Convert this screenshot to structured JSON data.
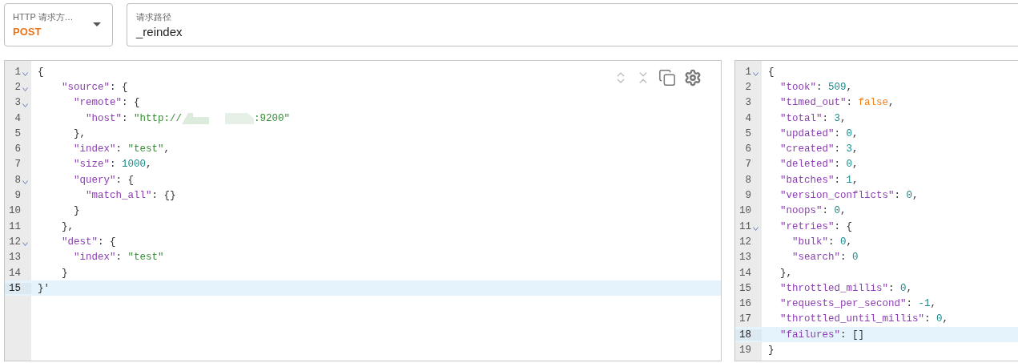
{
  "method_field": {
    "label": "HTTP 请求方…",
    "value": "POST"
  },
  "path_field": {
    "label": "请求路径",
    "value": "_reindex"
  },
  "request_editor": {
    "toolbar": [
      {
        "kind": "unfold"
      },
      {
        "kind": "fold"
      },
      {
        "kind": "copy"
      },
      {
        "kind": "settings"
      }
    ],
    "lines": [
      {
        "number": "1",
        "foldable": true,
        "active": false,
        "tokens": [
          {
            "kind": "punct",
            "text": "{"
          }
        ]
      },
      {
        "number": "2",
        "foldable": true,
        "active": false,
        "tokens": [
          {
            "kind": "key",
            "text": "    ″source″"
          },
          {
            "kind": "punct",
            "text": ": {"
          }
        ]
      },
      {
        "number": "3",
        "foldable": true,
        "active": false,
        "tokens": [
          {
            "kind": "key",
            "text": "      ″remote″"
          },
          {
            "kind": "punct",
            "text": ": {"
          }
        ]
      },
      {
        "number": "4",
        "foldable": false,
        "active": false,
        "tokens": [
          {
            "kind": "key",
            "text": "        ″host″"
          },
          {
            "kind": "punct",
            "text": ": "
          },
          {
            "kind": "string",
            "text": "″http://"
          },
          {
            "kind": "redacted"
          },
          {
            "kind": "string",
            "text": ":9200″"
          }
        ]
      },
      {
        "number": "5",
        "foldable": false,
        "active": false,
        "tokens": [
          {
            "kind": "punct",
            "text": "      },"
          }
        ]
      },
      {
        "number": "6",
        "foldable": false,
        "active": false,
        "tokens": [
          {
            "kind": "key",
            "text": "      ″index″"
          },
          {
            "kind": "punct",
            "text": ": "
          },
          {
            "kind": "string",
            "text": "″test″"
          },
          {
            "kind": "punct",
            "text": ","
          }
        ]
      },
      {
        "number": "7",
        "foldable": false,
        "active": false,
        "tokens": [
          {
            "kind": "key",
            "text": "      ″size″"
          },
          {
            "kind": "punct",
            "text": ": "
          },
          {
            "kind": "number",
            "text": "1000"
          },
          {
            "kind": "punct",
            "text": ","
          }
        ]
      },
      {
        "number": "8",
        "foldable": true,
        "active": false,
        "tokens": [
          {
            "kind": "key",
            "text": "      ″query″"
          },
          {
            "kind": "punct",
            "text": ": {"
          }
        ]
      },
      {
        "number": "9",
        "foldable": false,
        "active": false,
        "tokens": [
          {
            "kind": "key",
            "text": "        ″match_all″"
          },
          {
            "kind": "punct",
            "text": ": {}"
          }
        ]
      },
      {
        "number": "10",
        "foldable": false,
        "active": false,
        "tokens": [
          {
            "kind": "punct",
            "text": "      }"
          }
        ]
      },
      {
        "number": "11",
        "foldable": false,
        "active": false,
        "tokens": [
          {
            "kind": "punct",
            "text": "    },"
          }
        ]
      },
      {
        "number": "12",
        "foldable": true,
        "active": false,
        "tokens": [
          {
            "kind": "key",
            "text": "    ″dest″"
          },
          {
            "kind": "punct",
            "text": ": {"
          }
        ]
      },
      {
        "number": "13",
        "foldable": false,
        "active": false,
        "tokens": [
          {
            "kind": "key",
            "text": "      ″index″"
          },
          {
            "kind": "punct",
            "text": ": "
          },
          {
            "kind": "string",
            "text": "″test″"
          }
        ]
      },
      {
        "number": "14",
        "foldable": false,
        "active": false,
        "tokens": [
          {
            "kind": "punct",
            "text": "    }"
          }
        ]
      },
      {
        "number": "15",
        "foldable": false,
        "active": true,
        "tokens": [
          {
            "kind": "punct",
            "text": "}'"
          }
        ]
      }
    ]
  },
  "response_editor": {
    "lines": [
      {
        "number": "1",
        "foldable": true,
        "active": false,
        "tokens": [
          {
            "kind": "punct",
            "text": "{"
          }
        ]
      },
      {
        "number": "2",
        "foldable": false,
        "active": false,
        "tokens": [
          {
            "kind": "key",
            "text": "  ″took″"
          },
          {
            "kind": "punct",
            "text": ": "
          },
          {
            "kind": "number",
            "text": "509"
          },
          {
            "kind": "punct",
            "text": ","
          }
        ]
      },
      {
        "number": "3",
        "foldable": false,
        "active": false,
        "tokens": [
          {
            "kind": "key",
            "text": "  ″timed_out″"
          },
          {
            "kind": "punct",
            "text": ": "
          },
          {
            "kind": "bool",
            "text": "false"
          },
          {
            "kind": "punct",
            "text": ","
          }
        ]
      },
      {
        "number": "4",
        "foldable": false,
        "active": false,
        "tokens": [
          {
            "kind": "key",
            "text": "  ″total″"
          },
          {
            "kind": "punct",
            "text": ": "
          },
          {
            "kind": "number",
            "text": "3"
          },
          {
            "kind": "punct",
            "text": ","
          }
        ]
      },
      {
        "number": "5",
        "foldable": false,
        "active": false,
        "tokens": [
          {
            "kind": "key",
            "text": "  ″updated″"
          },
          {
            "kind": "punct",
            "text": ": "
          },
          {
            "kind": "number",
            "text": "0"
          },
          {
            "kind": "punct",
            "text": ","
          }
        ]
      },
      {
        "number": "6",
        "foldable": false,
        "active": false,
        "tokens": [
          {
            "kind": "key",
            "text": "  ″created″"
          },
          {
            "kind": "punct",
            "text": ": "
          },
          {
            "kind": "number",
            "text": "3"
          },
          {
            "kind": "punct",
            "text": ","
          }
        ]
      },
      {
        "number": "7",
        "foldable": false,
        "active": false,
        "tokens": [
          {
            "kind": "key",
            "text": "  ″deleted″"
          },
          {
            "kind": "punct",
            "text": ": "
          },
          {
            "kind": "number",
            "text": "0"
          },
          {
            "kind": "punct",
            "text": ","
          }
        ]
      },
      {
        "number": "8",
        "foldable": false,
        "active": false,
        "tokens": [
          {
            "kind": "key",
            "text": "  ″batches″"
          },
          {
            "kind": "punct",
            "text": ": "
          },
          {
            "kind": "number",
            "text": "1"
          },
          {
            "kind": "punct",
            "text": ","
          }
        ]
      },
      {
        "number": "9",
        "foldable": false,
        "active": false,
        "tokens": [
          {
            "kind": "key",
            "text": "  ″version_conflicts″"
          },
          {
            "kind": "punct",
            "text": ": "
          },
          {
            "kind": "number",
            "text": "0"
          },
          {
            "kind": "punct",
            "text": ","
          }
        ]
      },
      {
        "number": "10",
        "foldable": false,
        "active": false,
        "tokens": [
          {
            "kind": "key",
            "text": "  ″noops″"
          },
          {
            "kind": "punct",
            "text": ": "
          },
          {
            "kind": "number",
            "text": "0"
          },
          {
            "kind": "punct",
            "text": ","
          }
        ]
      },
      {
        "number": "11",
        "foldable": true,
        "active": false,
        "tokens": [
          {
            "kind": "key",
            "text": "  ″retries″"
          },
          {
            "kind": "punct",
            "text": ": {"
          }
        ]
      },
      {
        "number": "12",
        "foldable": false,
        "active": false,
        "tokens": [
          {
            "kind": "key",
            "text": "    ″bulk″"
          },
          {
            "kind": "punct",
            "text": ": "
          },
          {
            "kind": "number",
            "text": "0"
          },
          {
            "kind": "punct",
            "text": ","
          }
        ]
      },
      {
        "number": "13",
        "foldable": false,
        "active": false,
        "tokens": [
          {
            "kind": "key",
            "text": "    ″search″"
          },
          {
            "kind": "punct",
            "text": ": "
          },
          {
            "kind": "number",
            "text": "0"
          }
        ]
      },
      {
        "number": "14",
        "foldable": false,
        "active": false,
        "tokens": [
          {
            "kind": "punct",
            "text": "  },"
          }
        ]
      },
      {
        "number": "15",
        "foldable": false,
        "active": false,
        "tokens": [
          {
            "kind": "key",
            "text": "  ″throttled_millis″"
          },
          {
            "kind": "punct",
            "text": ": "
          },
          {
            "kind": "number",
            "text": "0"
          },
          {
            "kind": "punct",
            "text": ","
          }
        ]
      },
      {
        "number": "16",
        "foldable": false,
        "active": false,
        "tokens": [
          {
            "kind": "key",
            "text": "  ″requests_per_second″"
          },
          {
            "kind": "punct",
            "text": ": "
          },
          {
            "kind": "number",
            "text": "-1"
          },
          {
            "kind": "punct",
            "text": ","
          }
        ]
      },
      {
        "number": "17",
        "foldable": false,
        "active": false,
        "tokens": [
          {
            "kind": "key",
            "text": "  ″throttled_until_millis″"
          },
          {
            "kind": "punct",
            "text": ": "
          },
          {
            "kind": "number",
            "text": "0"
          },
          {
            "kind": "punct",
            "text": ","
          }
        ]
      },
      {
        "number": "18",
        "foldable": false,
        "active": true,
        "tokens": [
          {
            "kind": "key",
            "text": "  ″failures″"
          },
          {
            "kind": "punct",
            "text": ": []"
          }
        ]
      },
      {
        "number": "19",
        "foldable": false,
        "active": false,
        "tokens": [
          {
            "kind": "punct",
            "text": "}"
          }
        ]
      }
    ]
  }
}
